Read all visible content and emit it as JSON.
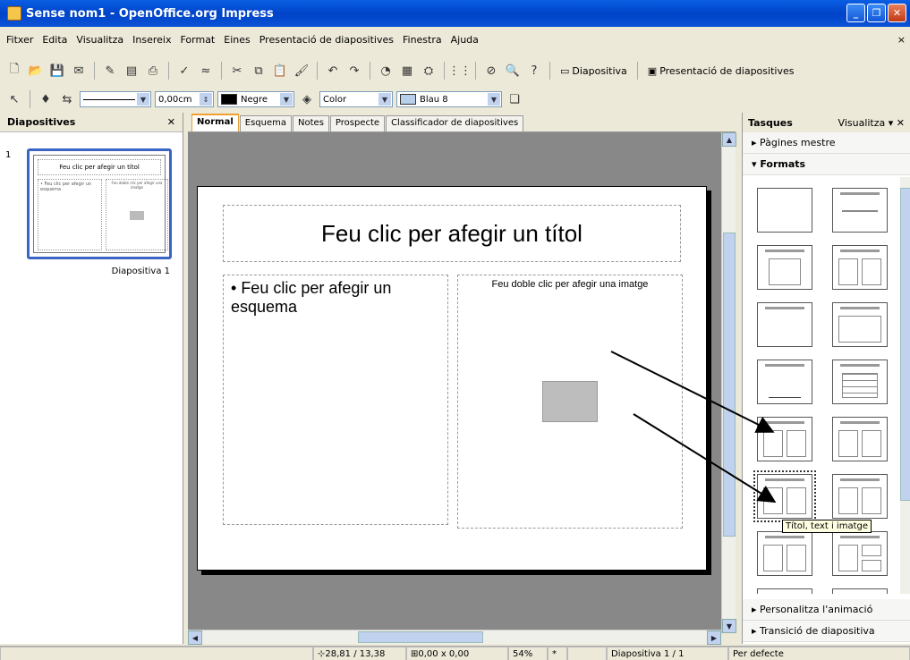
{
  "window": {
    "title": "Sense nom1 - OpenOffice.org Impress"
  },
  "menu": [
    "Fitxer",
    "Edita",
    "Visualitza",
    "Insereix",
    "Format",
    "Eines",
    "Presentació de diapositives",
    "Finestra",
    "Ajuda"
  ],
  "toolbar": {
    "slide_label": "Diapositiva",
    "slideshow_label": "Presentació de diapositives"
  },
  "format_bar": {
    "line_width": "0,00cm",
    "line_color": "Negre",
    "area_style": "Color",
    "area_color": "Blau 8",
    "line_color_hex": "#000000",
    "area_color_hex": "#b7cfe9"
  },
  "slides_pane": {
    "title": "Diapositives",
    "slide_number": "1",
    "thumb_title": "Feu clic per afegir un títol",
    "thumb_text": "• Feu clic per afegir un esquema",
    "thumb_img": "Feu doble clic per afegir una imatge",
    "caption": "Diapositiva 1"
  },
  "tabs": [
    "Normal",
    "Esquema",
    "Notes",
    "Prospecte",
    "Classificador de diapositives"
  ],
  "slide": {
    "title_placeholder": "Feu clic per afegir un títol",
    "text_placeholder": "Feu clic per afegir un esquema",
    "image_placeholder": "Feu doble clic per afegir una imatge"
  },
  "tasks_pane": {
    "title": "Tasques",
    "view_label": "Visualitza",
    "master_pages": "Pàgines mestre",
    "layouts": "Formats",
    "animation": "Personalitza l'animació",
    "transition": "Transició de diapositiva",
    "tooltip": "Títol, text i imatge"
  },
  "status": {
    "position": "28,81 / 13,38",
    "size": "0,00 x 0,00",
    "zoom": "54%",
    "modified": "*",
    "slide": "Diapositiva 1 / 1",
    "style": "Per defecte"
  }
}
